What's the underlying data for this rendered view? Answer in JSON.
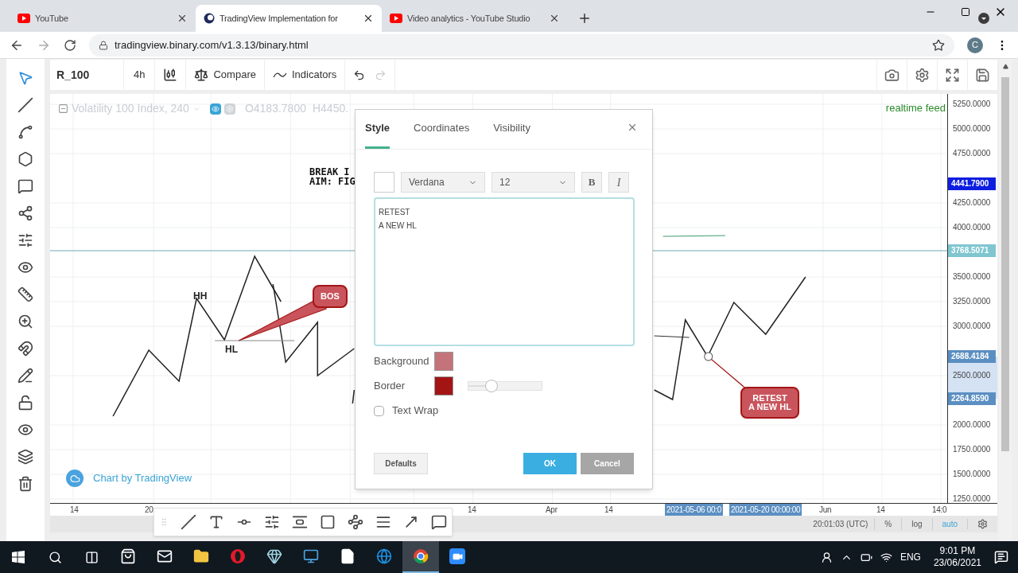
{
  "browser": {
    "tabs": [
      {
        "title": "YouTube",
        "kind": "youtube",
        "selected": false
      },
      {
        "title": "TradingView Implementation for",
        "kind": "globe",
        "selected": true
      },
      {
        "title": "Video analytics - YouTube Studio",
        "kind": "youtube",
        "selected": false
      }
    ],
    "address": "tradingview.binary.com/v1.3.13/binary.html",
    "profile": "C"
  },
  "toolbar": {
    "symbol": "R_100",
    "interval": "4h",
    "compare": "Compare",
    "indicators": "Indicators"
  },
  "legend": {
    "title": "Volatility 100 Index, 240",
    "open": "O4183.7800",
    "high": "H4450."
  },
  "realtime": "realtime feed",
  "annotations": [
    {
      "kind": "text",
      "text": "BREAK I"
    },
    {
      "kind": "text",
      "text": "AIM: FIG"
    },
    {
      "kind": "label",
      "text": "HH"
    },
    {
      "kind": "label",
      "text": "HL"
    },
    {
      "kind": "callout",
      "text": "BOS"
    },
    {
      "kind": "callout",
      "text": "RETEST\nA NEW HL"
    }
  ],
  "branding": "Chart by TradingView",
  "price_axis": [
    {
      "kind": "tick",
      "text": "5250.0000"
    },
    {
      "kind": "tick",
      "text": "5000.0000"
    },
    {
      "kind": "tick",
      "text": "4750.0000"
    },
    {
      "kind": "badge",
      "text": "4441.7900",
      "color": "#0d1ee0"
    },
    {
      "kind": "tick",
      "text": "4250.0000"
    },
    {
      "kind": "tick",
      "text": "4000.0000"
    },
    {
      "kind": "badge",
      "text": "3768.5071",
      "color": "#7fc6d0"
    },
    {
      "kind": "tick",
      "text": "3500.0000"
    },
    {
      "kind": "tick",
      "text": "3250.0000"
    },
    {
      "kind": "tick",
      "text": "3000.0000"
    },
    {
      "kind": "badge",
      "text": "2688.4184",
      "color": "#5b8fc2"
    },
    {
      "kind": "tick",
      "text": "2500.0000"
    },
    {
      "kind": "badge",
      "text": "2264.8590",
      "color": "#5b8fc2"
    },
    {
      "kind": "tick",
      "text": "2000.0000"
    },
    {
      "kind": "tick",
      "text": "1750.0000"
    },
    {
      "kind": "tick",
      "text": "1500.0000"
    },
    {
      "kind": "tick",
      "text": "1250.0000"
    }
  ],
  "time_axis": [
    {
      "text": "14",
      "selected": false
    },
    {
      "text": "20",
      "selected": false
    },
    {
      "text": "14",
      "selected": false
    },
    {
      "text": "Apr",
      "selected": false
    },
    {
      "text": "14",
      "selected": false
    },
    {
      "text": "2021-05-06 00:0",
      "selected": true
    },
    {
      "text": "2021-05-20 00:00:00",
      "selected": true
    },
    {
      "text": "Jun",
      "selected": false
    },
    {
      "text": "14",
      "selected": false
    },
    {
      "text": "14:0",
      "selected": false
    }
  ],
  "bottom_bar": {
    "time": "20:01:03 (UTC)",
    "options": [
      {
        "text": "%",
        "selected": false
      },
      {
        "text": "log",
        "selected": false
      },
      {
        "text": "auto",
        "selected": true
      }
    ]
  },
  "dialog": {
    "tabs": [
      {
        "label": "Style",
        "selected": true
      },
      {
        "label": "Coordinates",
        "selected": false
      },
      {
        "label": "Visibility",
        "selected": false
      }
    ],
    "font": "Verdana",
    "size": "12",
    "bold": "B",
    "italic": "I",
    "text": "RETEST\nA NEW HL",
    "background": {
      "label": "Background",
      "color": "#c4737a"
    },
    "border": {
      "label": "Border",
      "color": "#a31515",
      "level": 0.32
    },
    "text_wrap": {
      "label": "Text Wrap",
      "checked": false
    },
    "buttons": {
      "defaults": "Defaults",
      "ok": "OK",
      "cancel": "Cancel"
    }
  },
  "taskbar": {
    "apps": [
      {
        "kind": "store",
        "selected": false
      },
      {
        "kind": "mail",
        "selected": false
      },
      {
        "kind": "folder",
        "selected": false
      },
      {
        "kind": "opera",
        "selected": false
      },
      {
        "kind": "notes",
        "selected": false
      },
      {
        "kind": "monitor",
        "selected": false
      },
      {
        "kind": "file",
        "selected": false
      },
      {
        "kind": "edge",
        "selected": false
      },
      {
        "kind": "chrome",
        "selected": true
      },
      {
        "kind": "zoom",
        "selected": false
      }
    ],
    "language": "ENG",
    "time": "9:01 PM",
    "date": "23/06/2021"
  }
}
